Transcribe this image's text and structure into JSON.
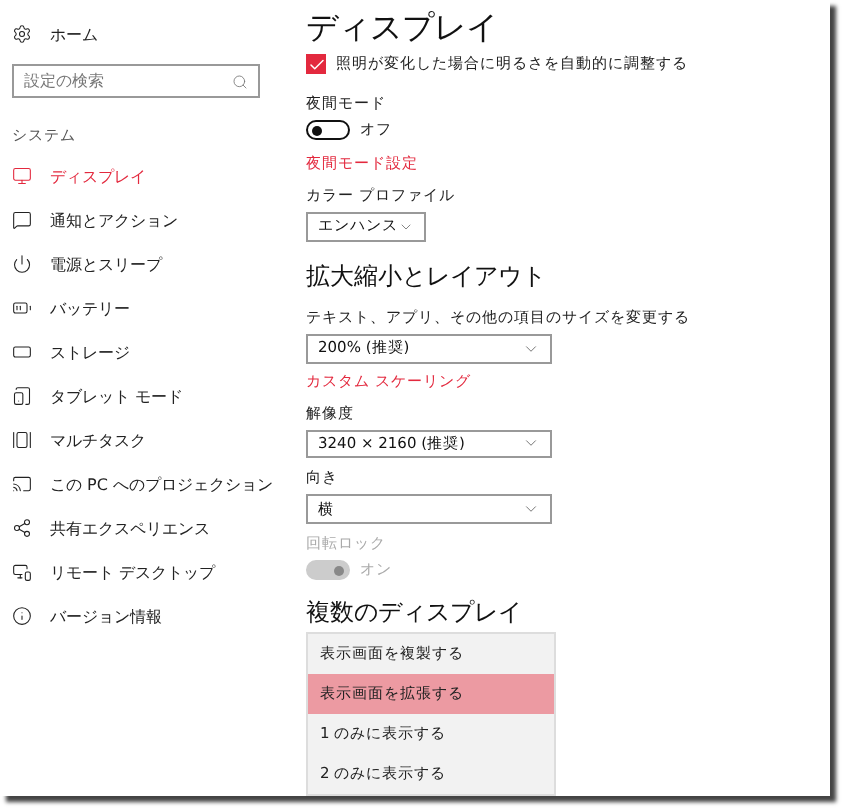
{
  "sidebar": {
    "home": "ホーム",
    "search": {
      "placeholder": "設定の検索"
    },
    "section": "システム",
    "items": [
      {
        "label": "ディスプレイ",
        "selected": true
      },
      {
        "label": "通知とアクション",
        "selected": false
      },
      {
        "label": "電源とスリープ",
        "selected": false
      },
      {
        "label": "バッテリー",
        "selected": false
      },
      {
        "label": "ストレージ",
        "selected": false
      },
      {
        "label": "タブレット モード",
        "selected": false
      },
      {
        "label": "マルチタスク",
        "selected": false
      },
      {
        "label": "この PC へのプロジェクション",
        "selected": false
      },
      {
        "label": "共有エクスペリエンス",
        "selected": false
      },
      {
        "label": "リモート デスクトップ",
        "selected": false
      },
      {
        "label": "バージョン情報",
        "selected": false
      }
    ]
  },
  "content": {
    "title": "ディスプレイ",
    "auto_brightness": {
      "label": "照明が変化した場合に明るさを自動的に調整する",
      "checked": true
    },
    "night_mode": {
      "label": "夜間モード",
      "on": false,
      "disabled": false,
      "state_text": "オフ"
    },
    "night_mode_link": "夜間モード設定",
    "color_profile": {
      "label": "カラー プロファイル",
      "value": "エンハンス"
    },
    "scale_heading": "拡大縮小とレイアウト",
    "scale": {
      "label": "テキスト、アプリ、その他の項目のサイズを変更する",
      "value": "200% (推奨)"
    },
    "custom_scaling_link": "カスタム スケーリング",
    "resolution": {
      "label": "解像度",
      "value": "3240 × 2160 (推奨)"
    },
    "orientation": {
      "label": "向き",
      "value": "横"
    },
    "rotation_lock": {
      "label": "回転ロック",
      "on": true,
      "disabled": true,
      "state_text": "オン"
    },
    "multi_heading": "複数のディスプレイ",
    "multi_options": [
      {
        "label": "表示画面を複製する",
        "selected": false
      },
      {
        "label": "表示画面を拡張する",
        "selected": true
      },
      {
        "label": "1 のみに表示する",
        "selected": false
      },
      {
        "label": "2 のみに表示する",
        "selected": false
      }
    ]
  }
}
